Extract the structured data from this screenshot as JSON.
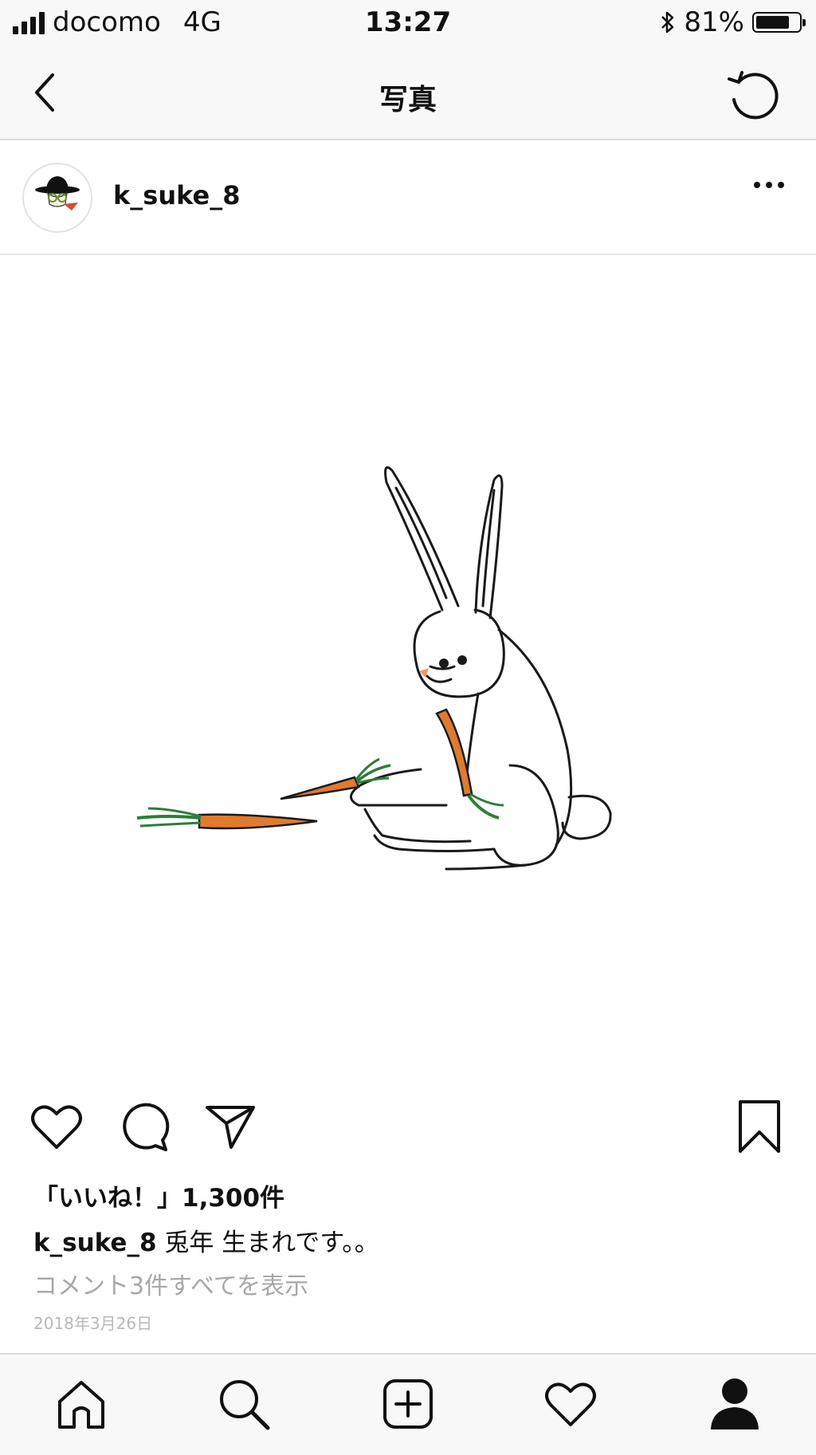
{
  "status_bar": {
    "carrier": "docomo",
    "network": "4G",
    "time": "13:27",
    "battery": "81%",
    "battery_level": 0.81
  },
  "nav": {
    "title": "写真",
    "back_icon": "chevron-left-icon",
    "refresh_icon": "refresh-icon"
  },
  "post": {
    "username": "k_suke_8",
    "likes": "「いいね！」1,300件",
    "caption_user": "k_suke_8",
    "caption_text": "兎年 生まれです。。",
    "comments_link": "コメント3件すべてを表示",
    "date": "2018年3月26日"
  },
  "actions": {
    "icons": [
      "heart-icon",
      "comment-icon",
      "share-icon",
      "bookmark-icon"
    ]
  },
  "tab_bar": {
    "icons": [
      "home-icon",
      "search-icon",
      "add-post-icon",
      "activity-heart-icon",
      "profile-icon"
    ]
  },
  "colors": {
    "carrot": "#e07a2c",
    "carrot_leaf": "#2f7d3a",
    "nose": "#e89a6a",
    "bars": "#f8f8f8"
  }
}
